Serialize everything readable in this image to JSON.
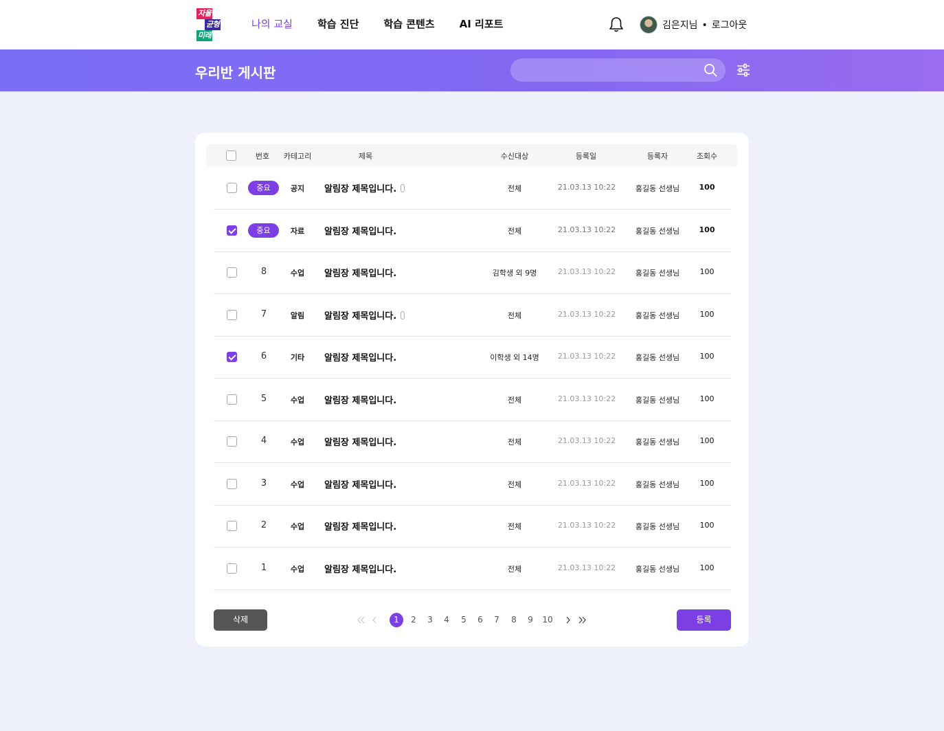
{
  "logo": {
    "line1": "자율",
    "line2": "균형",
    "line3": "미래"
  },
  "nav": {
    "items": [
      "나의 교실",
      "학습 진단",
      "학습 콘텐츠",
      "AI 리포트"
    ],
    "active_index": 0
  },
  "user": {
    "name": "김은지님",
    "separator": "•",
    "logout": "로그아웃"
  },
  "icons": {
    "bell": "bell-icon",
    "search": "search-icon",
    "filter": "sliders-icon",
    "attachment": "paperclip-icon",
    "first": "double-chevron-left-icon",
    "prev": "chevron-left-icon",
    "next": "chevron-right-icon",
    "last": "double-chevron-right-icon"
  },
  "banner": {
    "title": "우리반 게시판",
    "search_placeholder": ""
  },
  "table": {
    "headers": {
      "number": "번호",
      "category": "카테고리",
      "title": "제목",
      "target": "수신대상",
      "date": "등록일",
      "writer": "등록자",
      "views": "조회수"
    },
    "rows": [
      {
        "checked": false,
        "badge": "중요",
        "number": "",
        "category": "공지",
        "title": "알림장 제목입니다.",
        "attachment": true,
        "target": "전체",
        "date": "21.03.13 10:22",
        "writer": "홍길동 선생님",
        "views": "100",
        "important": true
      },
      {
        "checked": true,
        "badge": "중요",
        "number": "",
        "category": "자료",
        "title": "알림장 제목입니다.",
        "attachment": false,
        "target": "전체",
        "date": "21.03.13 10:22",
        "writer": "홍길동 선생님",
        "views": "100",
        "important": true
      },
      {
        "checked": false,
        "badge": "",
        "number": "8",
        "category": "수업",
        "title": "알림장 제목입니다.",
        "attachment": false,
        "target": "김학생 외 9명",
        "date": "21.03.13 10:22",
        "writer": "홍길동 선생님",
        "views": "100",
        "important": false
      },
      {
        "checked": false,
        "badge": "",
        "number": "7",
        "category": "알림",
        "title": "알림장 제목입니다.",
        "attachment": true,
        "target": "전체",
        "date": "21.03.13 10:22",
        "writer": "홍길동 선생님",
        "views": "100",
        "important": false
      },
      {
        "checked": true,
        "badge": "",
        "number": "6",
        "category": "기타",
        "title": "알림장 제목입니다.",
        "attachment": false,
        "target": "이학생 외 14명",
        "date": "21.03.13 10:22",
        "writer": "홍길동 선생님",
        "views": "100",
        "important": false
      },
      {
        "checked": false,
        "badge": "",
        "number": "5",
        "category": "수업",
        "title": "알림장 제목입니다.",
        "attachment": false,
        "target": "전체",
        "date": "21.03.13 10:22",
        "writer": "홍길동 선생님",
        "views": "100",
        "important": false
      },
      {
        "checked": false,
        "badge": "",
        "number": "4",
        "category": "수업",
        "title": "알림장 제목입니다.",
        "attachment": false,
        "target": "전체",
        "date": "21.03.13 10:22",
        "writer": "홍길동 선생님",
        "views": "100",
        "important": false
      },
      {
        "checked": false,
        "badge": "",
        "number": "3",
        "category": "수업",
        "title": "알림장 제목입니다.",
        "attachment": false,
        "target": "전체",
        "date": "21.03.13 10:22",
        "writer": "홍길동 선생님",
        "views": "100",
        "important": false
      },
      {
        "checked": false,
        "badge": "",
        "number": "2",
        "category": "수업",
        "title": "알림장 제목입니다.",
        "attachment": false,
        "target": "전체",
        "date": "21.03.13 10:22",
        "writer": "홍길동 선생님",
        "views": "100",
        "important": false
      },
      {
        "checked": false,
        "badge": "",
        "number": "1",
        "category": "수업",
        "title": "알림장 제목입니다.",
        "attachment": false,
        "target": "전체",
        "date": "21.03.13 10:22",
        "writer": "홍길동 선생님",
        "views": "100",
        "important": false
      }
    ]
  },
  "buttons": {
    "delete": "삭제",
    "register": "등록"
  },
  "pagination": {
    "pages": [
      "1",
      "2",
      "3",
      "4",
      "5",
      "6",
      "7",
      "8",
      "9",
      "10"
    ],
    "current": "1"
  },
  "colors": {
    "accent": "#7b3fe4",
    "banner_start": "#7a6ef5",
    "banner_end": "#9a6cf0",
    "background": "#eef0fb",
    "delete_button": "#555555"
  }
}
